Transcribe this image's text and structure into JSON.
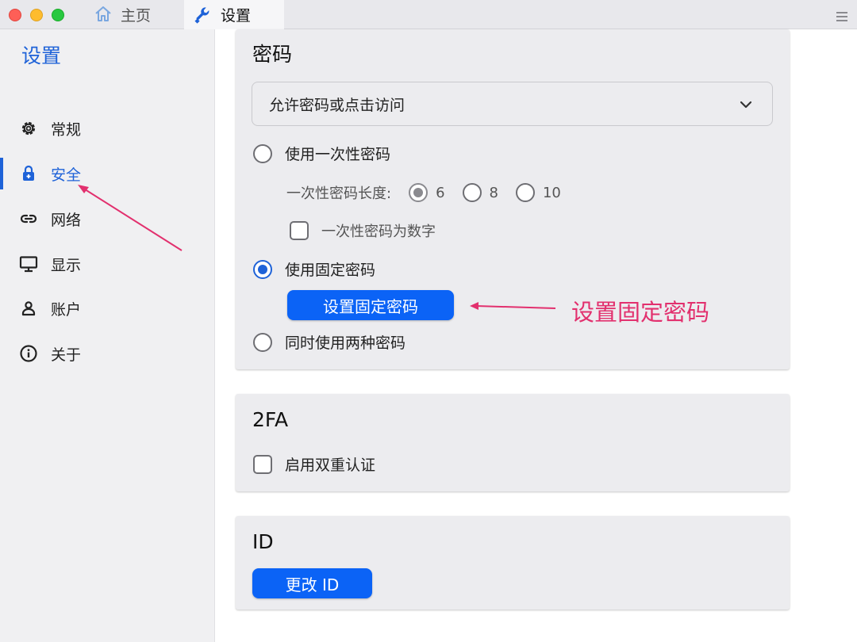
{
  "tabs": [
    {
      "label": "主页",
      "icon": "home-icon"
    },
    {
      "label": "设置",
      "icon": "wrench-icon"
    }
  ],
  "sidebar": {
    "title": "设置",
    "items": [
      {
        "label": "常规",
        "icon": "gear-icon"
      },
      {
        "label": "安全",
        "icon": "lock-icon",
        "active": true
      },
      {
        "label": "网络",
        "icon": "link-icon"
      },
      {
        "label": "显示",
        "icon": "monitor-icon"
      },
      {
        "label": "账户",
        "icon": "user-icon"
      },
      {
        "label": "关于",
        "icon": "info-icon"
      }
    ]
  },
  "password_card": {
    "title": "密码",
    "access_select": {
      "value": "允许密码或点击访问"
    },
    "one_time_option": "使用一次性密码",
    "length_label": "一次性密码长度:",
    "length_options": [
      "6",
      "8",
      "10"
    ],
    "length_selected": "6",
    "numeric_checkbox": "一次性密码为数字",
    "fixed_option": "使用固定密码",
    "set_fixed_button": "设置固定密码",
    "both_option": "同时使用两种密码",
    "selected_option": "fixed"
  },
  "twofa_card": {
    "title": "2FA",
    "enable_checkbox": "启用双重认证"
  },
  "id_card": {
    "title": "ID",
    "change_button": "更改 ID"
  },
  "annotation": {
    "text": "设置固定密码",
    "color": "#e2306e"
  },
  "colors": {
    "accent": "#1e62d8",
    "primary_button": "#0b63f6"
  }
}
